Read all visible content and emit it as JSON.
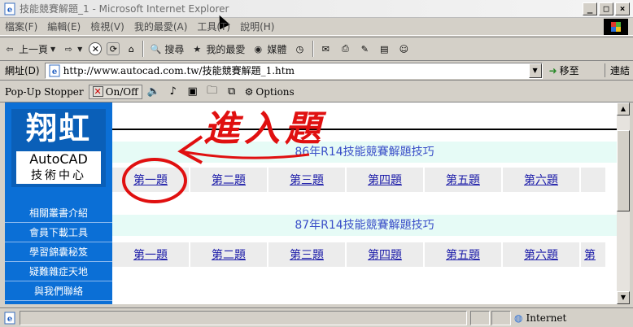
{
  "window": {
    "title": "技能競賽解題_1 - Microsoft Internet Explorer",
    "buttons": [
      "_",
      "□",
      "×"
    ]
  },
  "menu": [
    "檔案(F)",
    "編輯(E)",
    "檢視(V)",
    "我的最愛(A)",
    "工具(T)",
    "說明(H)"
  ],
  "toolbar": {
    "back": "上一頁",
    "search": "搜尋",
    "favorites": "我的最愛",
    "media": "媒體"
  },
  "address": {
    "label": "網址(D)",
    "url": "http://www.autocad.com.tw/技能競賽解題_1.htm",
    "go": "移至",
    "links": "連結"
  },
  "popup": {
    "label": "Pop-Up Stopper",
    "onoff": "On/Off",
    "options": "Options"
  },
  "logo": {
    "top": "翔虹",
    "mid": "AutoCAD",
    "bot": "技術中心"
  },
  "nav": [
    "相關叢書介紹",
    "會員下載工具",
    "學習錦囊秘笈",
    "疑難雜症天地",
    "與我們聯絡"
  ],
  "sections": [
    {
      "title": "86年R14技能競賽解題技巧",
      "questions": [
        "第一題",
        "第二題",
        "第三題",
        "第四題",
        "第五題",
        "第六題"
      ]
    },
    {
      "title": "87年R14技能競賽解題技巧",
      "questions": [
        "第一題",
        "第二題",
        "第三題",
        "第四題",
        "第五題",
        "第六題",
        "第"
      ]
    }
  ],
  "annotation": {
    "text": "進入題"
  },
  "status": {
    "zone": "Internet"
  },
  "colors": {
    "sidebar": "#0b6fd6",
    "section_bg": "#e6fbf6",
    "section_text": "#3a4fc8",
    "link": "#1a1aa8",
    "annotation": "#e01010"
  }
}
